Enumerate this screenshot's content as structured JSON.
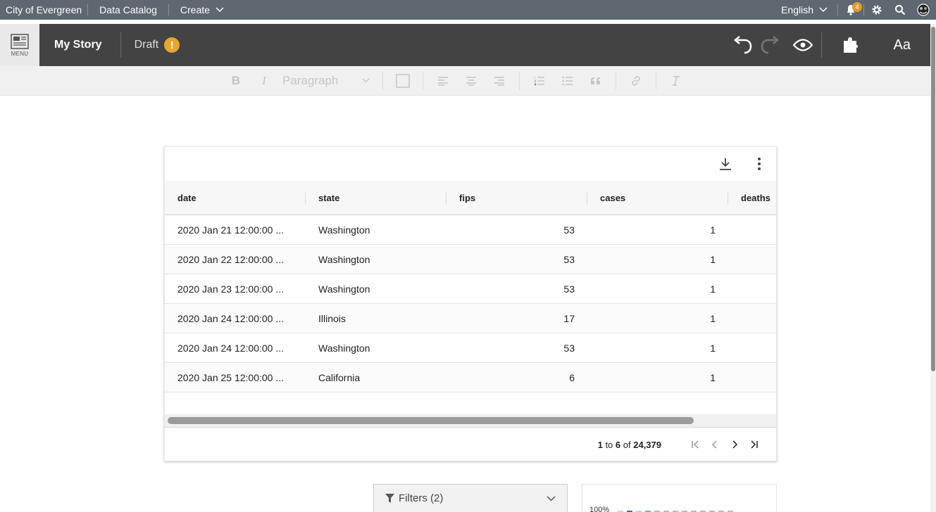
{
  "topnav": {
    "site_name": "City of Evergreen",
    "links": [
      "Data Catalog",
      "Create"
    ],
    "language": "English",
    "notification_count": "4"
  },
  "header": {
    "menu_label": "MENU",
    "story_title": "My Story",
    "status": "Draft",
    "status_icon": "!",
    "font_button": "Aa"
  },
  "toolbar": {
    "bold": "B",
    "italic": "I",
    "paragraph_select": "Paragraph"
  },
  "table": {
    "columns": [
      "date",
      "state",
      "fips",
      "cases",
      "deaths"
    ],
    "rows": [
      [
        "2020 Jan 21 12:00:00 ...",
        "Washington",
        "53",
        "1"
      ],
      [
        "2020 Jan 22 12:00:00 ...",
        "Washington",
        "53",
        "1"
      ],
      [
        "2020 Jan 23 12:00:00 ...",
        "Washington",
        "53",
        "1"
      ],
      [
        "2020 Jan 24 12:00:00 ...",
        "Illinois",
        "17",
        "1"
      ],
      [
        "2020 Jan 24 12:00:00 ...",
        "Washington",
        "53",
        "1"
      ],
      [
        "2020 Jan 25 12:00:00 ...",
        "California",
        "6",
        "1"
      ]
    ],
    "pager": {
      "from": "1",
      "to_word": "to",
      "to": "6",
      "of_word": "of",
      "total": "24,379"
    }
  },
  "filters": {
    "label": "Filters (2)"
  },
  "mini_chart": {
    "axis_label": "100%"
  },
  "colors": {
    "topnav_bg": "#5f6770",
    "header_bg": "#434343",
    "warning": "#e5a731",
    "badge": "#e59a2a"
  }
}
